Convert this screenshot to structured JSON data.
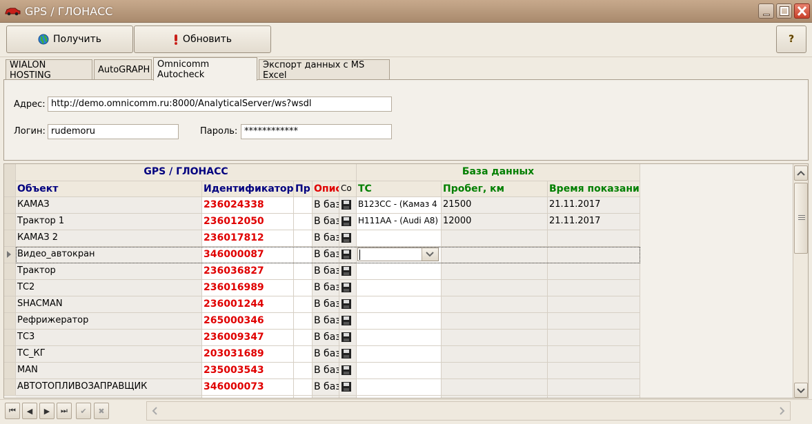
{
  "window": {
    "title": "GPS / ГЛОНАСС"
  },
  "toolbar": {
    "get_label": "Получить",
    "refresh_label": "Обновить",
    "help_label": "?"
  },
  "tabs": [
    {
      "label": "WIALON HOSTING"
    },
    {
      "label": "AutoGRAPH"
    },
    {
      "label": "Omnicomm Autocheck"
    },
    {
      "label": "Экспорт данных с MS Excel"
    }
  ],
  "form": {
    "address_label": "Адрес:",
    "address_value": "http://demo.omnicomm.ru:8000/AnalyticalServer/ws?wsdl",
    "login_label": "Логин:",
    "login_value": "rudemoru",
    "password_label": "Пароль:",
    "password_value": "************"
  },
  "grid": {
    "group_left": "GPS / ГЛОНАСС",
    "group_right": "База данных",
    "columns": [
      "Объект",
      "Идентификатор",
      "Пр",
      "Описание",
      "Со",
      "ТС",
      "Пробег, км",
      "Время показания"
    ],
    "rows": [
      {
        "obj": "КАМАЗ",
        "id": "236024338",
        "desc": "В базе",
        "ts": "В123СС - (Камаз 4",
        "km": "21500",
        "time": "21.11.2017"
      },
      {
        "obj": "Трактор 1",
        "id": "236012050",
        "desc": "В базе",
        "ts": "Н111АА - (Audi A8)",
        "km": "12000",
        "time": "21.11.2017"
      },
      {
        "obj": "КАМАЗ 2",
        "id": "236017812",
        "desc": "В базе",
        "ts": "",
        "km": "",
        "time": ""
      },
      {
        "obj": "Видео_автокран",
        "id": "346000087",
        "desc": "В базе",
        "ts": "",
        "km": "",
        "time": ""
      },
      {
        "obj": "Трактор",
        "id": "236036827",
        "desc": "В базе",
        "ts": "",
        "km": "",
        "time": ""
      },
      {
        "obj": "ТС2",
        "id": "236016989",
        "desc": "В базе",
        "ts": "",
        "km": "",
        "time": ""
      },
      {
        "obj": "SHACMAN",
        "id": "236001244",
        "desc": "В базе",
        "ts": "",
        "km": "",
        "time": ""
      },
      {
        "obj": "Рефрижератор",
        "id": "265000346",
        "desc": "В базе",
        "ts": "",
        "km": "",
        "time": ""
      },
      {
        "obj": "ТС3",
        "id": "236009347",
        "desc": "В базе",
        "ts": "",
        "km": "",
        "time": ""
      },
      {
        "obj": "ТС_КГ",
        "id": "203031689",
        "desc": "В базе",
        "ts": "",
        "km": "",
        "time": ""
      },
      {
        "obj": "MAN",
        "id": "235003543",
        "desc": "В базе",
        "ts": "",
        "km": "",
        "time": ""
      },
      {
        "obj": "АВТОТОПЛИВОЗАПРАВЩИК",
        "id": "346000073",
        "desc": "В базе",
        "ts": "",
        "km": "",
        "time": ""
      }
    ],
    "selected_row": 3
  },
  "colors": {
    "header_blue": "#00007f",
    "header_red": "#e00000",
    "header_green": "#007f00",
    "id_red": "#e00000"
  }
}
